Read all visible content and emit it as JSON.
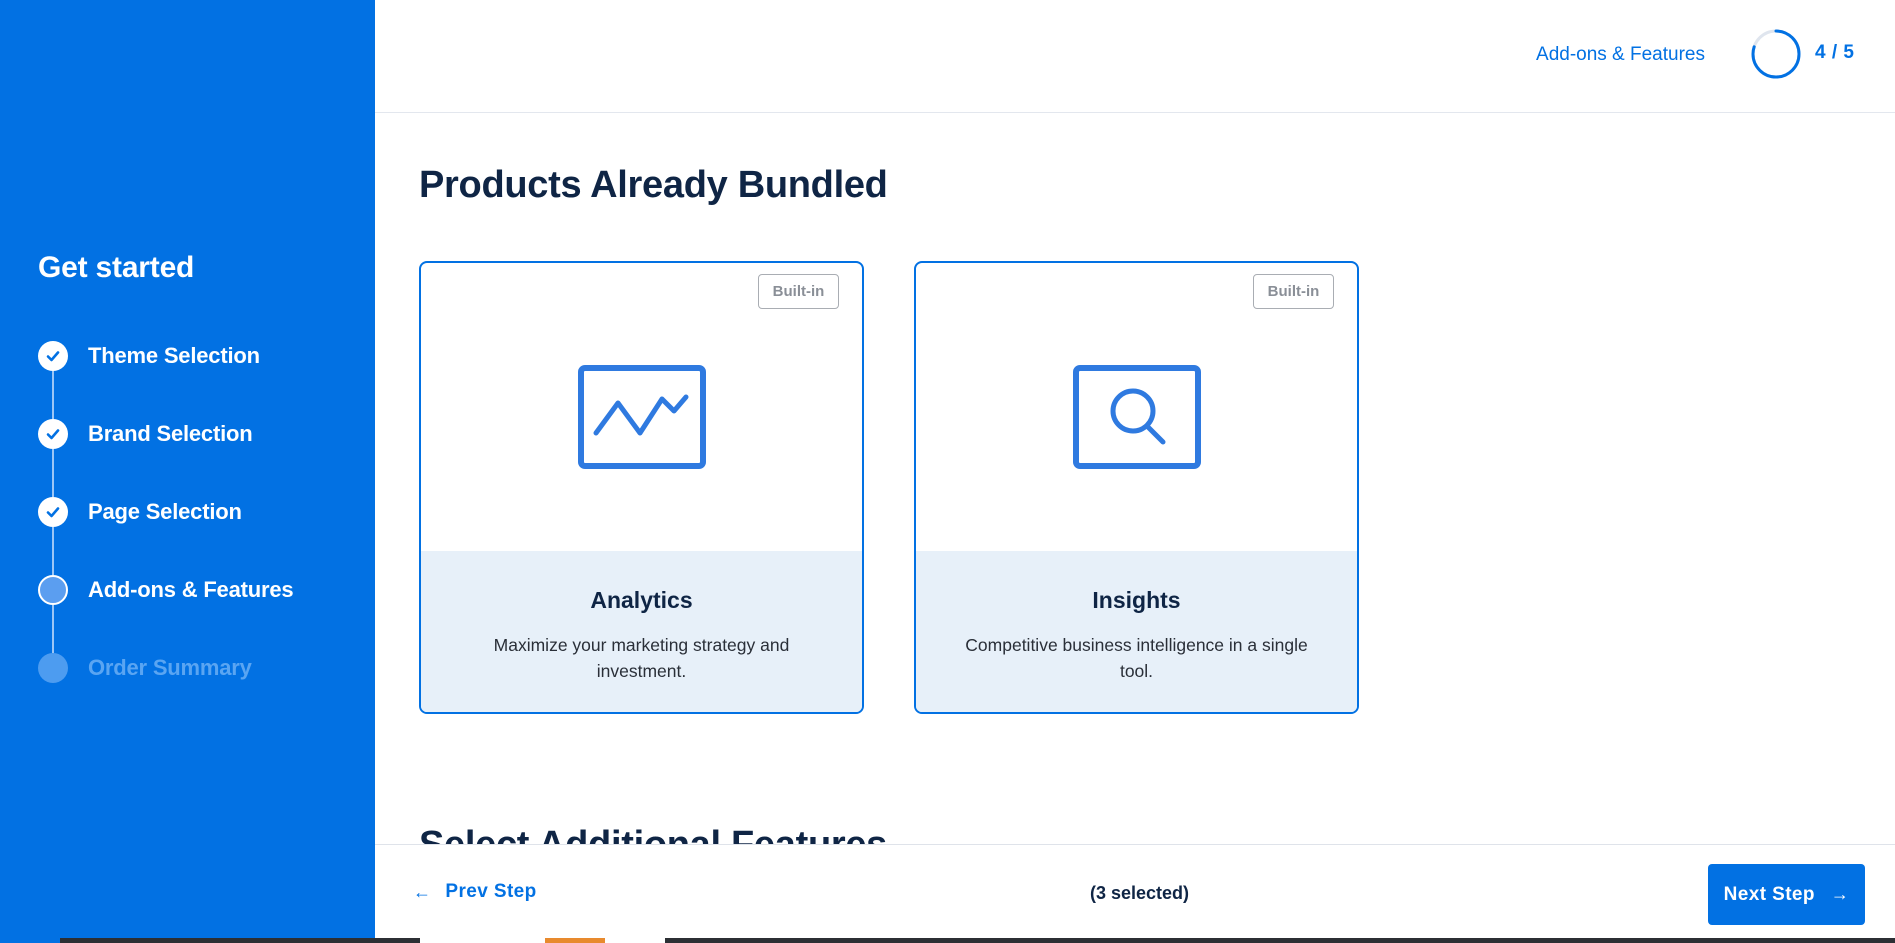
{
  "sidebar": {
    "title": "Get started",
    "steps": [
      {
        "label": "Theme Selection",
        "status": "done"
      },
      {
        "label": "Brand Selection",
        "status": "done"
      },
      {
        "label": "Page Selection",
        "status": "done"
      },
      {
        "label": "Add-ons & Features",
        "status": "current"
      },
      {
        "label": "Order Summary",
        "status": "pending"
      }
    ]
  },
  "header": {
    "current_step_name": "Add-ons & Features",
    "progress_text": "4 / 5",
    "progress_fraction": 0.8
  },
  "main": {
    "section_title": "Products Already Bundled",
    "next_section_title": "Select Additional Features",
    "cards": [
      {
        "badge": "Built-in",
        "name": "Analytics",
        "description": "Maximize your marketing strategy and investment.",
        "icon": "analytics-chart-icon"
      },
      {
        "badge": "Built-in",
        "name": "Insights",
        "description": "Competitive business intelligence in a single tool.",
        "icon": "insights-search-icon"
      }
    ]
  },
  "footer": {
    "prev_label": "Prev Step",
    "selected_text": "(3 selected)",
    "next_label": "Next Step"
  },
  "colors": {
    "brand_blue": "#0271e3",
    "dark_text": "#0f2545",
    "card_bottom_bg": "#e7f0f9",
    "icon_blue": "#2f7ae0"
  }
}
